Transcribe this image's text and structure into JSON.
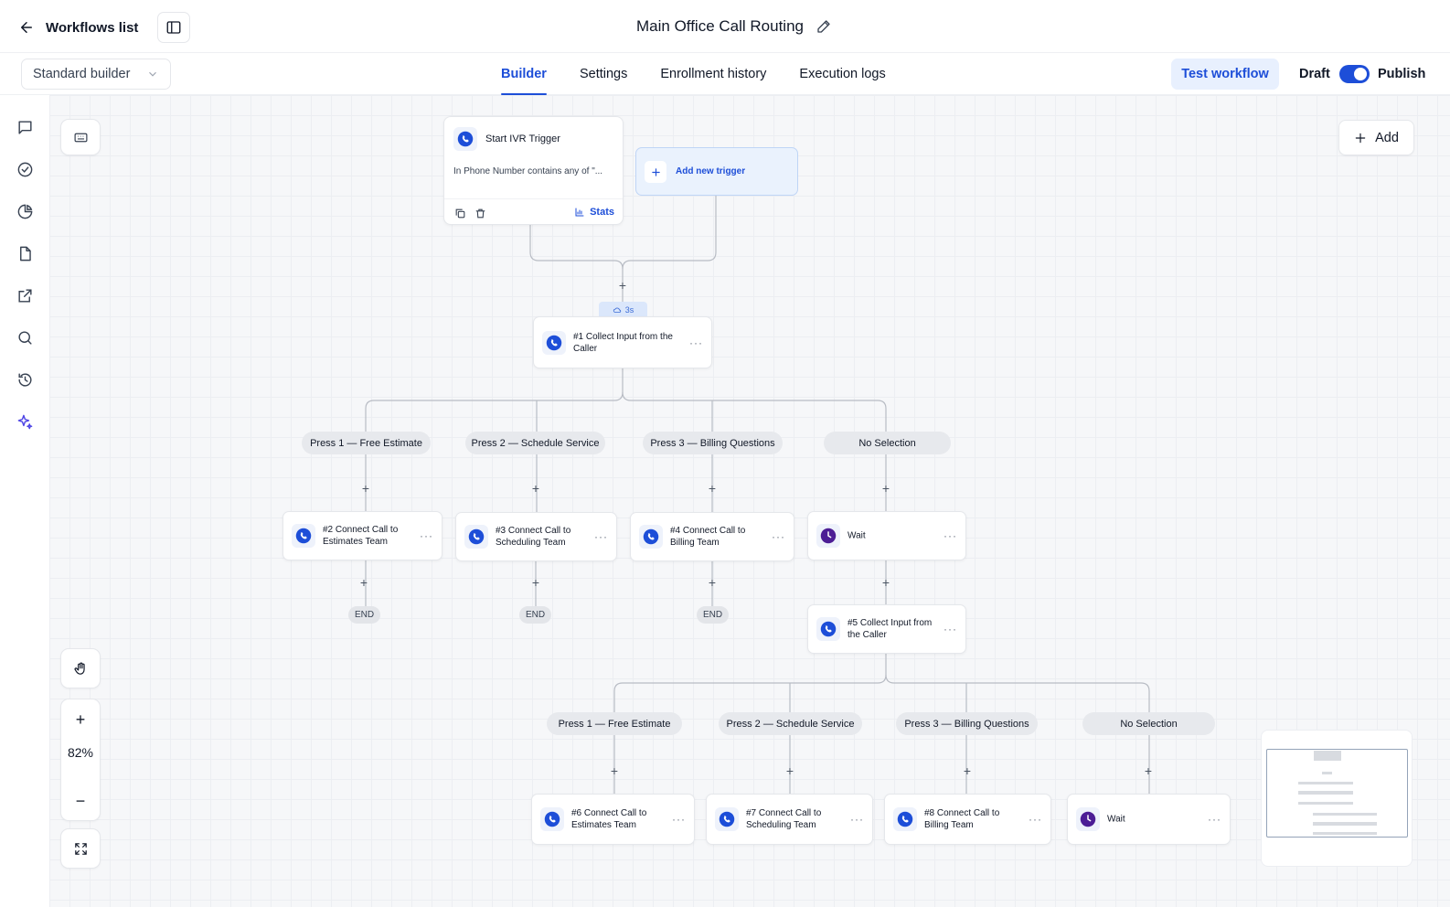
{
  "header": {
    "back_label": "Workflows list",
    "title": "Main Office Call Routing"
  },
  "toolbar": {
    "builder_mode": "Standard builder",
    "tabs": [
      {
        "label": "Builder",
        "active": true
      },
      {
        "label": "Settings",
        "active": false
      },
      {
        "label": "Enrollment history",
        "active": false
      },
      {
        "label": "Execution logs",
        "active": false
      }
    ],
    "test_label": "Test workflow",
    "draft_label": "Draft",
    "publish_label": "Publish",
    "publish_on": true
  },
  "sidebar": {
    "icons": [
      "chat-icon",
      "check-circle-icon",
      "pie-chart-icon",
      "document-icon",
      "external-link-icon",
      "search-icon",
      "history-icon",
      "sparkles-icon"
    ]
  },
  "canvas": {
    "add_label": "Add",
    "zoom": "82%",
    "trigger": {
      "title": "Start IVR Trigger",
      "condition": "In Phone Number contains any of \"...",
      "stats_label": "Stats"
    },
    "add_trigger_label": "Add new trigger",
    "delay": "3s",
    "collect_1": "#1 Collect Input from the Caller",
    "branches_1": [
      "Press 1 — Free Estimate",
      "Press 2 — Schedule Service",
      "Press 3 — Billing Questions",
      "No Selection"
    ],
    "actions_1": [
      "#2 Connect Call to Estimates Team",
      "#3 Connect Call to Scheduling Team",
      "#4 Connect Call to Billing Team",
      "Wait"
    ],
    "end_label": "END",
    "collect_5": "#5 Collect Input from the Caller",
    "branches_2": [
      "Press 1 — Free Estimate",
      "Press 2 — Schedule Service",
      "Press 3 — Billing Questions",
      "No Selection"
    ],
    "actions_2": [
      "#6 Connect Call to Estimates Team",
      "#7 Connect Call to Scheduling Team",
      "#8 Connect Call to Billing Team",
      "Wait"
    ]
  },
  "colors": {
    "accent": "#1d4ed8",
    "wait_icon": "#4c1d95",
    "pill_bg": "#e7e9ed"
  }
}
